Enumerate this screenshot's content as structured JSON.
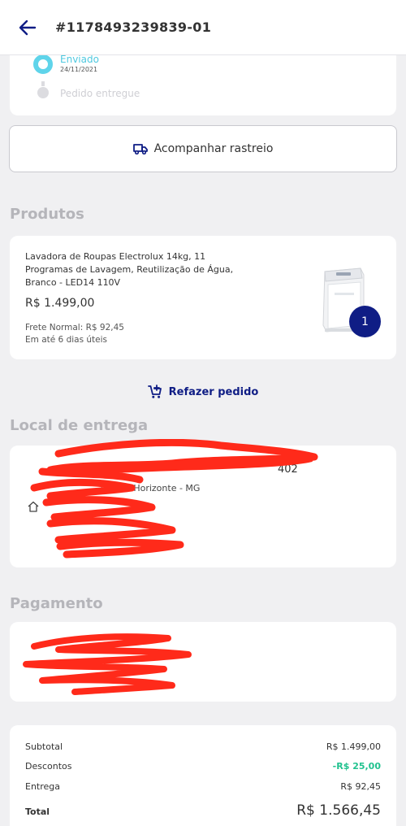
{
  "header": {
    "order_number": "#1178493239839-01"
  },
  "timeline": {
    "current_status": "Enviado",
    "current_date": "24/11/2021",
    "next_status": "Pedido entregue"
  },
  "tracking": {
    "button_label": "Acompanhar rastreio"
  },
  "products": {
    "section_title": "Produtos",
    "items": [
      {
        "name": "Lavadora de Roupas Electrolux 14kg, 11 Programas de Lavagem, Reutilização de Água, Branco - LED14 110V",
        "price": "R$ 1.499,00",
        "shipping_label": "Frete Normal: R$ 92,45",
        "delivery_time": "Em até 6 dias úteis",
        "quantity": "1",
        "image_icon": "washing-machine-icon"
      }
    ],
    "reorder_label": "Refazer pedido"
  },
  "delivery": {
    "section_title": "Local de entrega",
    "address_line1": "402",
    "address_line2": "s, Belo Horizonte - MG"
  },
  "payment": {
    "section_title": "Pagamento"
  },
  "summary": {
    "subtotal_label": "Subtotal",
    "subtotal_value": "R$ 1.499,00",
    "discount_label": "Descontos",
    "discount_value": "-R$ 25,00",
    "delivery_label": "Entrega",
    "delivery_value": "R$ 92,45",
    "total_label": "Total",
    "total_value": "R$ 1.566,45"
  },
  "colors": {
    "brand_navy": "#0f1d85",
    "status_cyan": "#5fd4ea",
    "discount_green": "#21c28f",
    "redaction_red": "#ff2a1a"
  }
}
